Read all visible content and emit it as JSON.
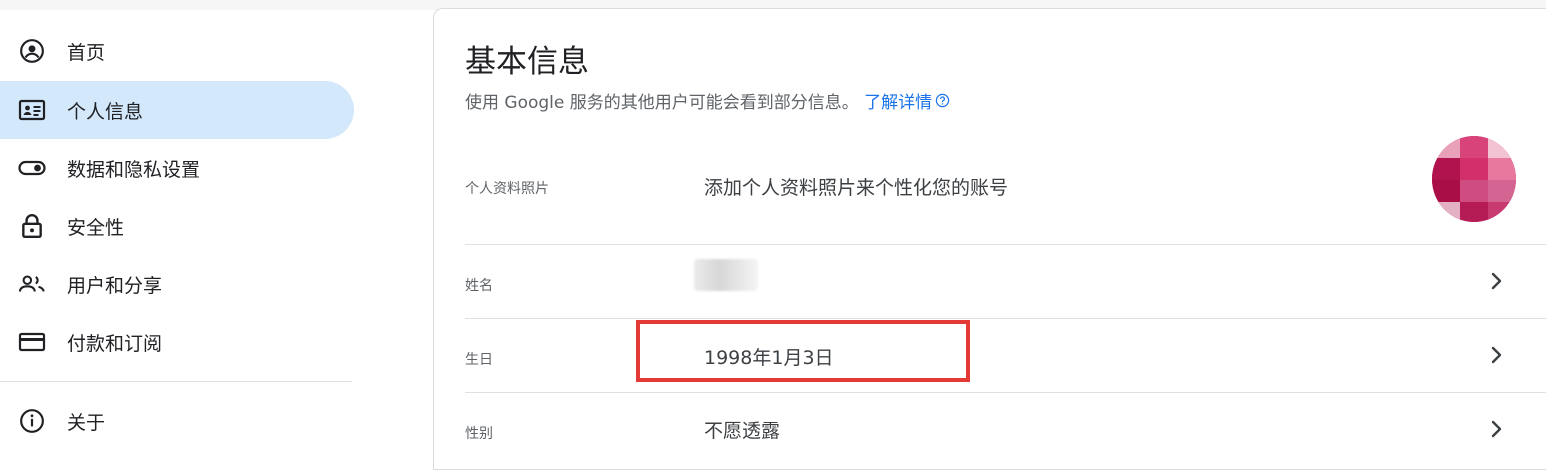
{
  "sidebar": {
    "items": [
      {
        "label": "首页",
        "icon": "account-circle-icon",
        "active": false
      },
      {
        "label": "个人信息",
        "icon": "id-card-icon",
        "active": true
      },
      {
        "label": "数据和隐私设置",
        "icon": "toggle-icon",
        "active": false
      },
      {
        "label": "安全性",
        "icon": "lock-icon",
        "active": false
      },
      {
        "label": "用户和分享",
        "icon": "people-icon",
        "active": false
      },
      {
        "label": "付款和订阅",
        "icon": "credit-card-icon",
        "active": false
      },
      {
        "label": "关于",
        "icon": "info-icon",
        "active": false
      }
    ]
  },
  "main": {
    "title": "基本信息",
    "subtitle": "使用 Google 服务的其他用户可能会看到部分信息。",
    "learn_more": "了解详情",
    "rows": {
      "photo": {
        "label": "个人资料照片",
        "value": "添加个人资料照片来个性化您的账号"
      },
      "name": {
        "label": "姓名",
        "value": ""
      },
      "birthday": {
        "label": "生日",
        "value": "1998年1月3日"
      },
      "gender": {
        "label": "性别",
        "value": "不愿透露"
      }
    }
  },
  "colors": {
    "accent": "#1a73e8",
    "active_nav_bg": "#d3e8fb",
    "highlight_border": "#e53935"
  }
}
